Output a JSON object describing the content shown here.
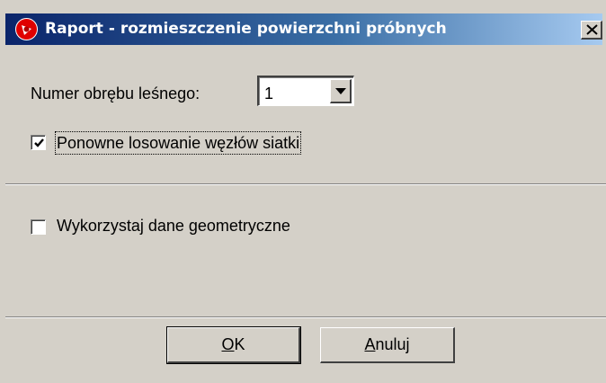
{
  "window": {
    "title": "Raport - rozmieszczenie powierzchni próbnych",
    "close_symbol": "×"
  },
  "forest_district": {
    "label": "Numer obrębu leśnego:",
    "selected_value": "1"
  },
  "options": {
    "resample_nodes": {
      "label": "Ponowne losowanie węzłów siatki",
      "checked": true
    },
    "use_geometry": {
      "label": "Wykorzystaj dane geometryczne",
      "checked": false
    }
  },
  "buttons": {
    "ok": {
      "mnemonic": "O",
      "rest": "K"
    },
    "cancel": {
      "mnemonic": "A",
      "rest": "nuluj"
    }
  },
  "colors": {
    "dialog_bg": "#d4d0c8",
    "titlebar_start": "#0a246a",
    "titlebar_end": "#a6caf0",
    "title_text": "#ffffff"
  },
  "icons": {
    "app": "red-circle-app-icon",
    "close": "close-icon",
    "dropdown": "dropdown-arrow-icon",
    "check": "checkmark-icon"
  }
}
